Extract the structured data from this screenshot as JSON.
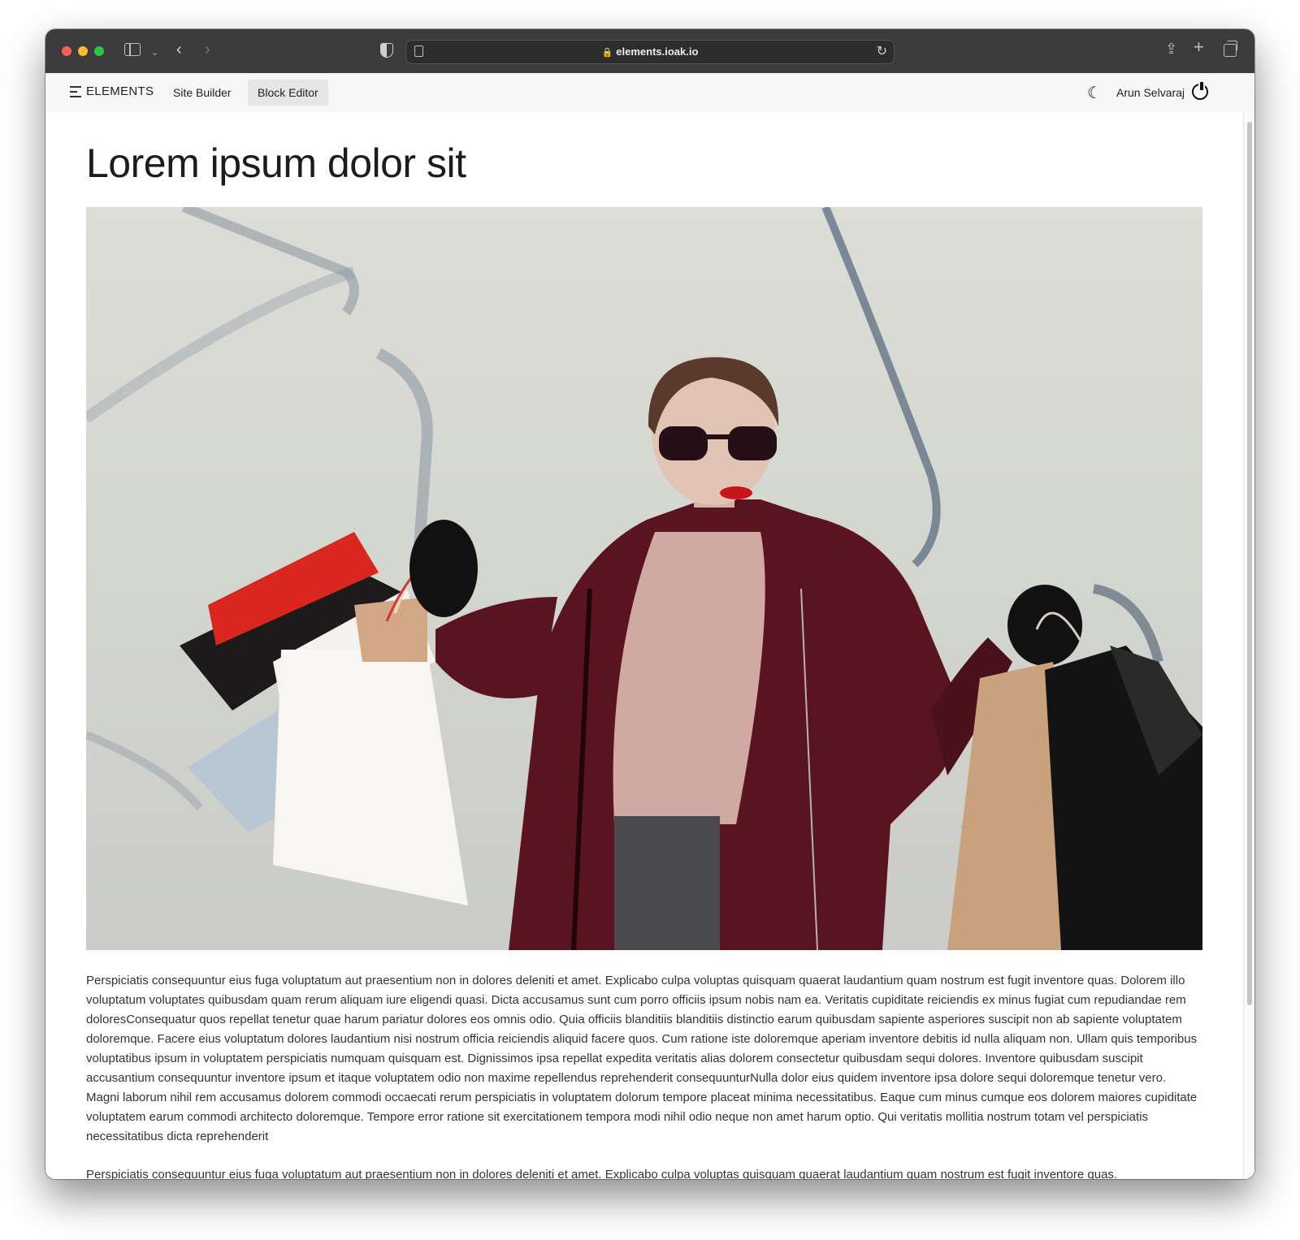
{
  "browser": {
    "url": "elements.ioak.io"
  },
  "navbar": {
    "brand": "ELEMENTS",
    "items": [
      {
        "label": "Site Builder",
        "active": false
      },
      {
        "label": "Block Editor",
        "active": true
      }
    ],
    "user_name": "Arun Selvaraj"
  },
  "content": {
    "title": "Lorem ipsum dolor sit",
    "paragraphs": [
      "Perspiciatis consequuntur eius fuga voluptatum aut praesentium non in dolores deleniti et amet. Explicabo culpa voluptas quisquam quaerat laudantium quam nostrum est fugit inventore quas. Dolorem illo voluptatum voluptates quibusdam quam rerum aliquam iure eligendi quasi. Dicta accusamus sunt cum porro officiis ipsum nobis nam ea. Veritatis cupiditate reiciendis ex minus fugiat cum repudiandae rem doloresConsequatur quos repellat tenetur quae harum pariatur dolores eos omnis odio. Quia officiis blanditiis blanditiis distinctio earum quibusdam sapiente asperiores suscipit non ab sapiente voluptatem doloremque. Facere eius voluptatum dolores laudantium nisi nostrum officia reiciendis aliquid facere quos. Cum ratione iste doloremque aperiam inventore debitis id nulla aliquam non. Ullam quis temporibus voluptatibus ipsum in voluptatem perspiciatis numquam quisquam est. Dignissimos ipsa repellat expedita veritatis alias dolorem consectetur quibusdam sequi dolores. Inventore quibusdam suscipit accusantium consequuntur inventore ipsum et itaque voluptatem odio non maxime repellendus reprehenderit consequunturNulla dolor eius quidem inventore ipsa dolore sequi doloremque tenetur vero. Magni laborum nihil rem accusamus dolorem commodi occaecati rerum perspiciatis in voluptatem dolorum tempore placeat minima necessitatibus. Eaque cum minus cumque eos dolorem maiores cupiditate voluptatem earum commodi architecto doloremque. Tempore error ratione sit exercitationem tempora modi nihil odio neque non amet harum optio. Qui veritatis mollitia nostrum totam vel perspiciatis necessitatibus dicta reprehenderit",
      "Perspiciatis consequuntur eius fuga voluptatum aut praesentium non in dolores deleniti et amet. Explicabo culpa voluptas quisquam quaerat laudantium quam nostrum est fugit inventore quas."
    ]
  },
  "icons": {
    "menu": "hamburger-icon",
    "theme": "moon-icon",
    "logout": "power-icon"
  },
  "colors": {
    "titlebar": "#3b3b3b",
    "navbar": "#f7f7f7",
    "active_nav": "#e6e6e6",
    "coat": "#5a1420"
  }
}
